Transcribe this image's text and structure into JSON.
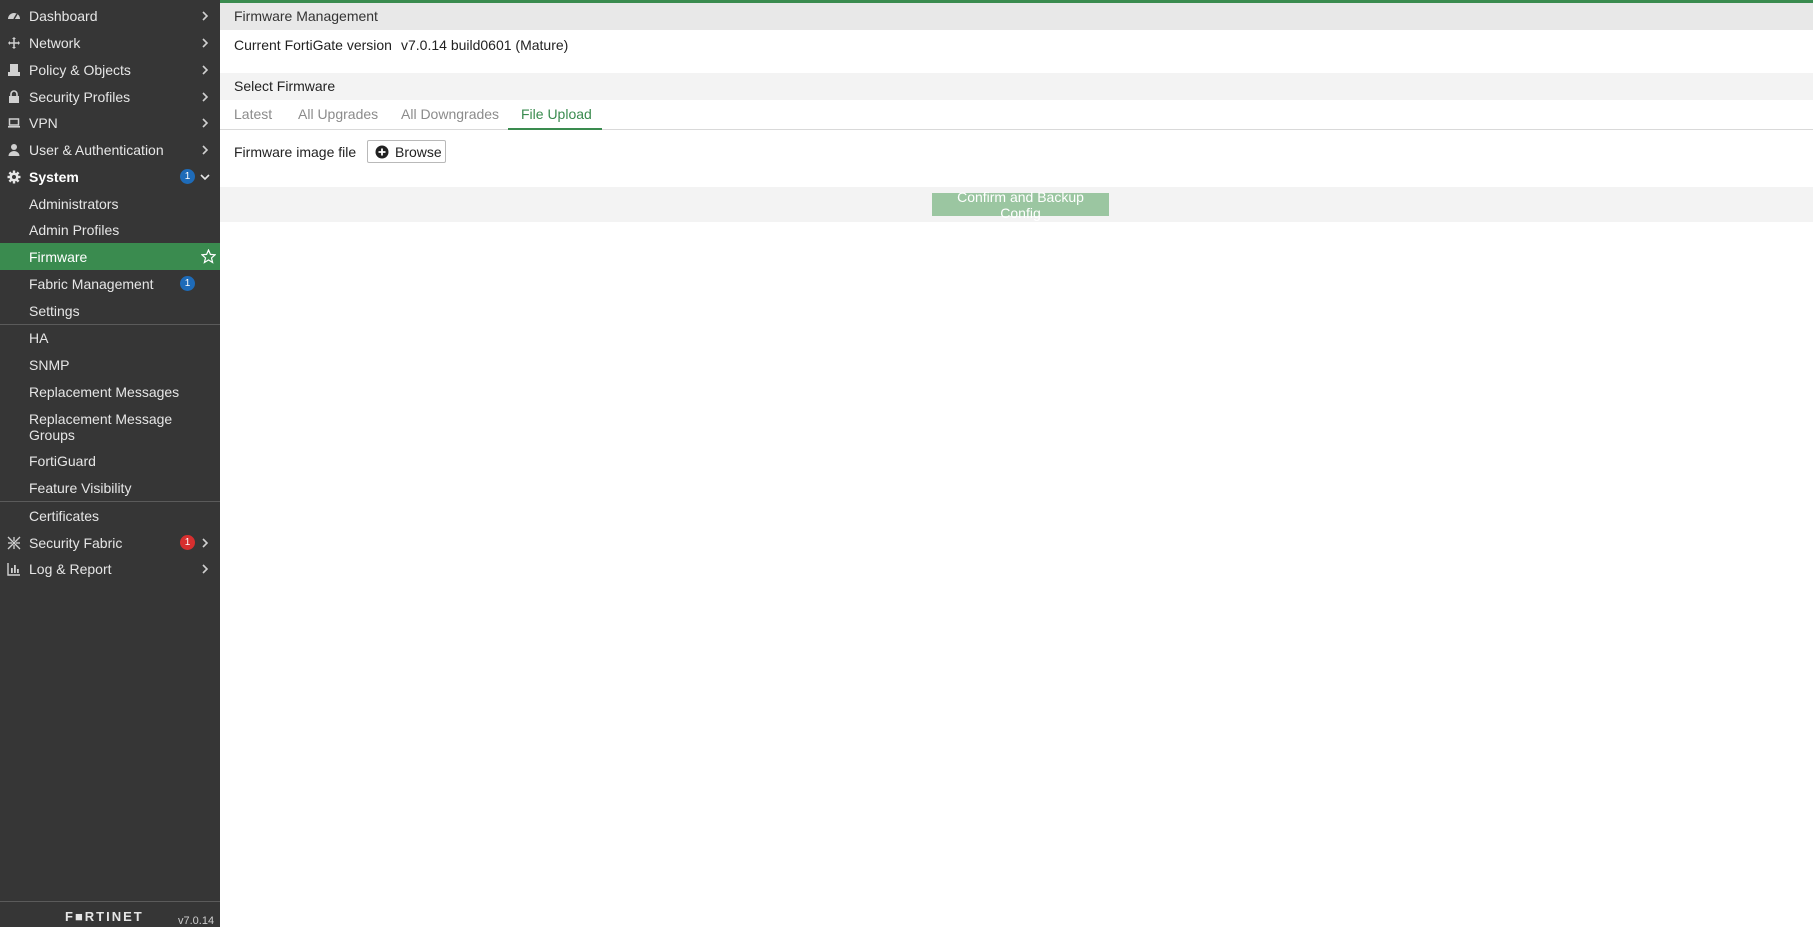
{
  "sidebar": {
    "items": [
      {
        "label": "Dashboard",
        "icon": "dashboard-icon"
      },
      {
        "label": "Network",
        "icon": "network-icon"
      },
      {
        "label": "Policy & Objects",
        "icon": "policy-icon"
      },
      {
        "label": "Security Profiles",
        "icon": "lock-icon"
      },
      {
        "label": "VPN",
        "icon": "laptop-icon"
      },
      {
        "label": "User & Authentication",
        "icon": "user-icon"
      },
      {
        "label": "System",
        "icon": "gear-icon",
        "badge": "1"
      },
      {
        "label": "Administrators"
      },
      {
        "label": "Admin Profiles"
      },
      {
        "label": "Firmware"
      },
      {
        "label": "Fabric Management",
        "badge": "1"
      },
      {
        "label": "Settings"
      },
      {
        "label": "HA"
      },
      {
        "label": "SNMP"
      },
      {
        "label": "Replacement Messages"
      },
      {
        "label": "Replacement Message Groups"
      },
      {
        "label": "FortiGuard"
      },
      {
        "label": "Feature Visibility"
      },
      {
        "label": "Certificates"
      },
      {
        "label": "Security Fabric",
        "icon": "fabric-icon",
        "badge": "1"
      },
      {
        "label": "Log & Report",
        "icon": "chart-icon"
      }
    ],
    "logo": "F■RTINET",
    "version": "v7.0.14"
  },
  "main": {
    "title": "Firmware Management",
    "version_label": "Current FortiGate version",
    "version_value": "v7.0.14 build0601 (Mature)",
    "select_title": "Select Firmware",
    "tabs": [
      "Latest",
      "All Upgrades",
      "All Downgrades",
      "File Upload"
    ],
    "active_tab": "File Upload",
    "firmware_label": "Firmware image file",
    "browse_label": "Browse",
    "confirm_label": "Confirm and Backup Config"
  },
  "colors": {
    "accent": "#3a8b4f",
    "sidebar_bg": "#363636",
    "badge_blue": "#1e6bb8",
    "badge_red": "#d62f2f",
    "confirm_disabled": "#9bc6a1"
  }
}
